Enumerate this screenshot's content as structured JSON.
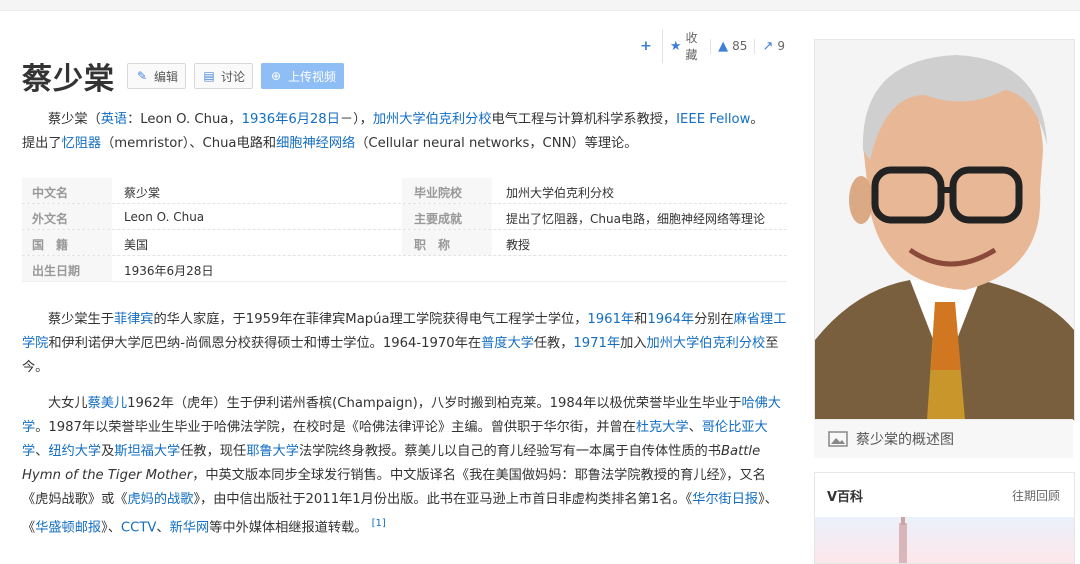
{
  "title": "蔡少棠",
  "buttons": {
    "edit": "编辑",
    "discuss": "讨论",
    "upload": "上传视频"
  },
  "actions": {
    "favorite": "收藏",
    "like_count": "85",
    "share_count": "9"
  },
  "summary": {
    "t1": "蔡少棠（",
    "l1": "英语",
    "t2": "：Leon O. Chua，",
    "l2": "1936年6月28日",
    "t3": "－），",
    "l3": "加州大学伯克利分校",
    "t4": "电气工程与计算机科学系教授，",
    "l4": "IEEE Fellow",
    "t5": "。",
    "t6": "提出了",
    "l5": "忆阻器",
    "t7": "（memristor）、Chua电路和",
    "l6": "细胞神经网络",
    "t8": "（Cellular neural networks，CNN）等理论。"
  },
  "infobox": {
    "left": [
      {
        "label": "中文名",
        "value": "蔡少棠"
      },
      {
        "label": "外文名",
        "value": "Leon O. Chua"
      },
      {
        "label": "国　籍",
        "value": "美国"
      },
      {
        "label": "出生日期",
        "value": "1936年6月28日"
      }
    ],
    "right": [
      {
        "label": "毕业院校",
        "value": "加州大学伯克利分校"
      },
      {
        "label": "主要成就",
        "value": "提出了忆阻器，Chua电路，细胞神经网络等理论"
      },
      {
        "label": "职　称",
        "value": "教授"
      }
    ]
  },
  "para1": {
    "t1": "蔡少棠生于",
    "l1": "菲律宾",
    "t2": "的华人家庭，于1959年在菲律宾Mapúa理工学院获得电气工程学士学位，",
    "l2": "1961年",
    "t3": "和",
    "l3": "1964年",
    "t4": "分别在",
    "l4": "麻省理工学院",
    "t5": "和伊利诺伊大学厄巴纳-尚佩恩分校获得硕士和博士学位。1964-1970年在",
    "l5": "普度大学",
    "t6": "任教，",
    "l6": "1971年",
    "t7": "加入",
    "l7": "加州大学伯克利分校",
    "t8": "至今。"
  },
  "para2": {
    "t1": "大女儿",
    "l1": "蔡美儿",
    "t2": "1962年（虎年）生于伊利诺州香槟(Champaign)，八岁时搬到柏克莱。1984年以极优荣誉毕业生毕业于",
    "l2": "哈佛大学",
    "t3": "。1987年以荣誉毕业生毕业于哈佛法学院，在校时是《哈佛法律评论》主编。曾供职于华尔街，并曾在",
    "l3": "杜克大学",
    "t4": "、",
    "l4": "哥伦比亚大学",
    "t5": "、",
    "l5": "纽约大学",
    "t6": "及",
    "l6": "斯坦福大学",
    "t7": "任教，现任",
    "l7": "耶鲁大学",
    "t8": "法学院终身教授。蔡美儿以自己的育儿经验写有一本属于自传体性质的书",
    "i1": "Battle Hymn of the Tiger Mother",
    "t9": "，中英文版本同步全球发行销售。中文版译名《我在美国做妈妈：耶鲁法学院教授的育儿经》，又名《虎妈战歌》或《",
    "l8": "虎妈的战歌",
    "t10": "》，由中信出版社于2011年1月份出版。此书在亚马逊上市首日非虚构类排名第1名。《",
    "l9": "华尔街日报",
    "t11": "》、《",
    "l10": "华盛顿邮报",
    "t12": "》、",
    "l11": "CCTV",
    "t13": "、",
    "l12": "新华网",
    "t14": "等中外媒体相继报道转载。",
    "ref": "[1]"
  },
  "sidebar": {
    "caption": "蔡少棠的概述图",
    "vbaike_title": "V百科",
    "vbaike_more": "往期回顾"
  },
  "colors": {
    "link": "#136ec2",
    "upload_btn": "#8fbdf6",
    "icon_blue": "#3f7fd8"
  }
}
